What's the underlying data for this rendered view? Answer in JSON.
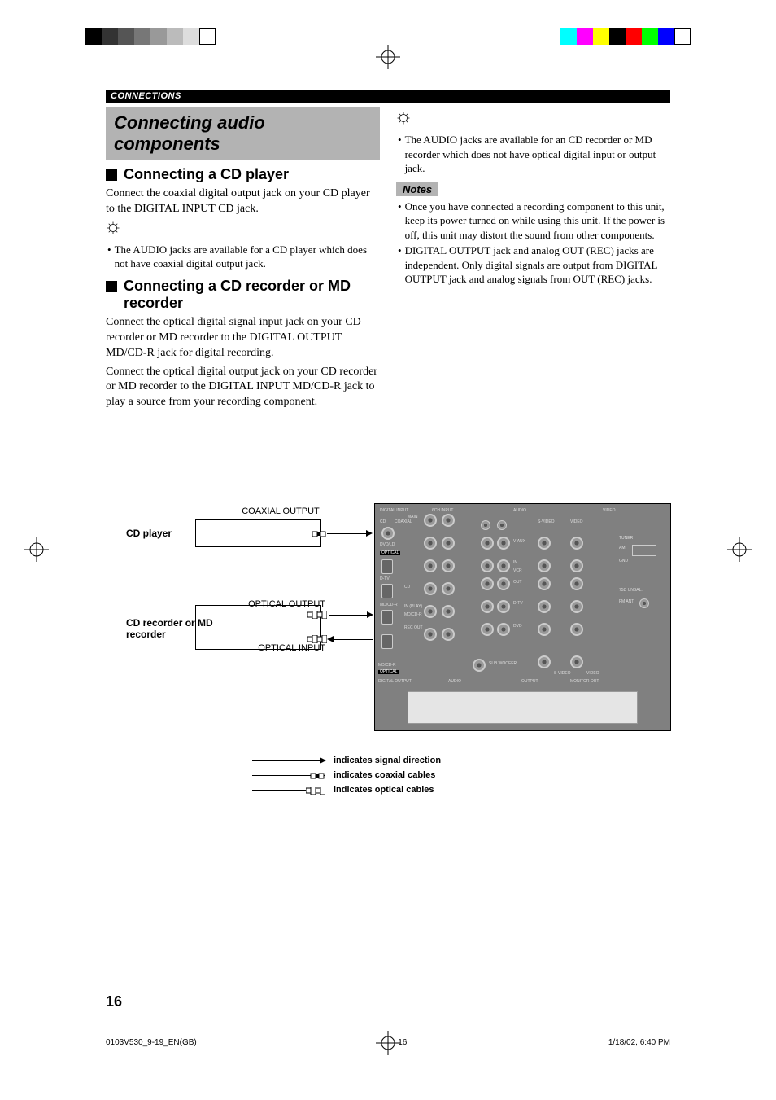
{
  "header": {
    "section": "CONNECTIONS"
  },
  "title": "Connecting audio components",
  "sections": {
    "cd_player": {
      "heading": "Connecting a CD player",
      "body": "Connect the coaxial digital output jack on your CD player to the DIGITAL INPUT CD jack.",
      "tip": "The AUDIO jacks are available for a CD player which does not have coaxial digital output jack."
    },
    "cd_md": {
      "heading": "Connecting a CD recorder or MD recorder",
      "body1": "Connect the optical digital signal input jack on your CD recorder or MD recorder to the DIGITAL OUTPUT MD/CD-R jack for digital recording.",
      "body2": "Connect the optical digital output jack on your CD recorder or MD recorder to the DIGITAL INPUT MD/CD-R jack to play a source from your recording component."
    },
    "right_tip": "The AUDIO jacks are available for an CD recorder or MD recorder which does not have optical digital input or output jack.",
    "notes_label": "Notes",
    "notes": [
      "Once you have connected a recording component to this unit, keep its power turned on while using this unit. If the power is off, this unit may distort the sound from other components.",
      "DIGITAL OUTPUT jack and analog OUT (REC) jacks are independent. Only digital signals are output from DIGITAL OUTPUT jack and analog signals from OUT (REC) jacks."
    ]
  },
  "diagram": {
    "cd_player_label": "CD player",
    "cd_md_label": "CD recorder or MD recorder",
    "coaxial_output": "COAXIAL OUTPUT",
    "optical_output": "OPTICAL OUTPUT",
    "optical_input": "OPTICAL INPUT",
    "panel": {
      "digital_input": "DIGITAL INPUT",
      "digital_output": "DIGITAL OUTPUT",
      "audio": "AUDIO",
      "output": "OUTPUT",
      "sixch": "6CH INPUT",
      "video": "VIDEO",
      "monitor_out": "MONITOR OUT",
      "cd": "CD",
      "dvd_ld": "DVD/LD",
      "optical": "OPTICAL",
      "dtv": "D-TV",
      "mdcdr": "MD/CD-R",
      "tuner": "TUNER",
      "vcr": "VCR",
      "dvd": "DVD",
      "dtv2": "D-TV",
      "vaux": "V-AUX",
      "in": "IN",
      "out": "OUT",
      "svideo": "S-VIDEO",
      "video2": "VIDEO",
      "subwoofer": "SUB WOOFER",
      "am": "AM",
      "gnd": "GND",
      "fm": "FM ANT",
      "tuner_ant": "75Ω UNBAL.",
      "main": "MAIN",
      "rec": "REC OUT",
      "play": "IN (PLAY)",
      "coaxial": "COAXIAL"
    }
  },
  "legend": {
    "signal": "indicates signal direction",
    "coax": "indicates coaxial cables",
    "optical": "indicates optical cables"
  },
  "page_number": "16",
  "footer": {
    "file": "0103V530_9-19_EN(GB)",
    "page": "16",
    "date": "1/18/02, 6:40 PM"
  },
  "colors": {
    "bar_left": [
      "#000",
      "#333",
      "#555",
      "#777",
      "#999",
      "#bbb",
      "#ddd",
      "#fff"
    ],
    "bar_right": [
      "#0ff",
      "#f0f",
      "#ff0",
      "#000",
      "#f00",
      "#0f0",
      "#00f",
      "#fff"
    ]
  }
}
